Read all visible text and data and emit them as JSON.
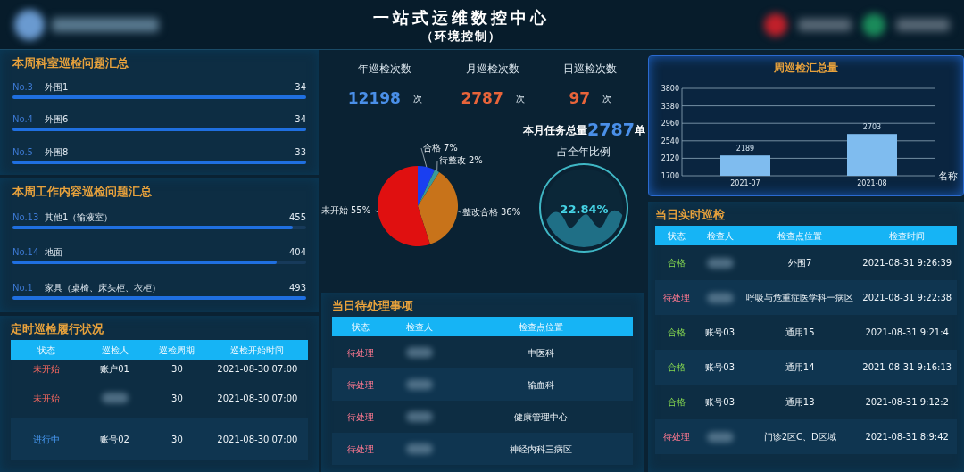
{
  "header": {
    "title": "一站式运维数控中心",
    "subtitle": "（环境控制）"
  },
  "dept_issues": {
    "title": "本周科室巡检问题汇总",
    "items": [
      {
        "rank": "No.3",
        "name": "外围1",
        "count": "34",
        "level": 1
      },
      {
        "rank": "No.4",
        "name": "外围6",
        "count": "34",
        "level": 1
      },
      {
        "rank": "No.5",
        "name": "外围8",
        "count": "33",
        "level": 1
      }
    ]
  },
  "work_issues": {
    "title": "本周工作内容巡检问题汇总",
    "items": [
      {
        "rank": "No.13",
        "name": "其他1（输液室）",
        "count": "455",
        "level": 0.955
      },
      {
        "rank": "No.14",
        "name": "地面",
        "count": "404",
        "level": 0.9
      },
      {
        "rank": "No.1",
        "name": "家具（桌椅、床头柜、衣柜）",
        "count": "493",
        "level": 1
      }
    ]
  },
  "schedule": {
    "title": "定时巡检履行状况",
    "columns": [
      "状态",
      "巡检人",
      "巡检周期",
      "巡检开始时间"
    ],
    "rows": [
      {
        "status": "未开始",
        "kind": "waiting",
        "inspector": "账户01",
        "cycle": "30",
        "start": "2021-08-30 07:00"
      },
      {
        "status": "未开始",
        "kind": "waiting",
        "cycle": "30",
        "start": "2021-08-30 07:00"
      },
      {
        "status": "进行中",
        "kind": "running",
        "inspector": "账号02",
        "cycle": "30",
        "start": "2021-08-30 07:00"
      }
    ]
  },
  "stats": [
    {
      "label": "年巡检次数",
      "value": "12198",
      "unit": "次",
      "color": "#4a8fe8"
    },
    {
      "label": "月巡检次数",
      "value": "2787",
      "unit": "次",
      "color": "#e8643a"
    },
    {
      "label": "日巡检次数",
      "value": "97",
      "unit": "次",
      "color": "#e8643a"
    }
  ],
  "pie": {
    "chart_data": {
      "type": "pie",
      "categories": [
        "合格",
        "待整改",
        "整改合格",
        "未开始"
      ],
      "values": [
        7,
        2,
        36,
        55
      ],
      "value_labels": [
        "7%",
        "2%",
        "36%",
        "55%"
      ],
      "colors": [
        "#1a3ff0",
        "#3a9a9a",
        "#c8731a",
        "#e01010"
      ]
    }
  },
  "monthly": {
    "label": "本月任务总量",
    "value": "2787",
    "unit": "单",
    "ratio_label": "占全年比例",
    "ratio": "22.84%"
  },
  "pending": {
    "title": "当日待处理事项",
    "columns": [
      "状态",
      "检查人",
      "检查点位置"
    ],
    "rows": [
      {
        "status": "待处理",
        "kind": "pending",
        "location": "中医科"
      },
      {
        "status": "待处理",
        "kind": "pending",
        "location": "输血科"
      },
      {
        "status": "待处理",
        "kind": "pending",
        "location": "健康管理中心"
      },
      {
        "status": "待处理",
        "kind": "pending",
        "location": "神经内科三病区"
      }
    ]
  },
  "weekly_chart": {
    "title": "周巡检汇总量",
    "chart_data": {
      "type": "bar",
      "xlabel": "名称",
      "categories": [
        "2021-07",
        "2021-08"
      ],
      "values": [
        2189,
        2703
      ],
      "ylim": [
        1700,
        3800
      ],
      "yticks": [
        1700,
        2120,
        2540,
        2960,
        3380,
        3800
      ],
      "grid": true,
      "data_labels": true
    }
  },
  "realtime": {
    "title": "当日实时巡检",
    "columns": [
      "状态",
      "检查人",
      "检查点位置",
      "检查时间"
    ],
    "rows": [
      {
        "status": "合格",
        "kind": "passed",
        "location": "外围7",
        "time": "2021-08-31 9:26:39"
      },
      {
        "status": "待处理",
        "kind": "pending",
        "location": "呼吸与危重症医学科一病区",
        "time": "2021-08-31 9:22:38"
      },
      {
        "status": "合格",
        "kind": "passed",
        "inspector": "账号03",
        "location": "通用15",
        "time": "2021-08-31 9:21:4"
      },
      {
        "status": "合格",
        "kind": "passed",
        "inspector": "账号03",
        "location": "通用14",
        "time": "2021-08-31 9:16:13"
      },
      {
        "status": "合格",
        "kind": "passed",
        "inspector": "账号03",
        "location": "通用13",
        "time": "2021-08-31 9:12:2"
      },
      {
        "status": "待处理",
        "kind": "pending",
        "location": "门诊2区C、D区域",
        "time": "2021-08-31 8:9:42"
      }
    ]
  }
}
